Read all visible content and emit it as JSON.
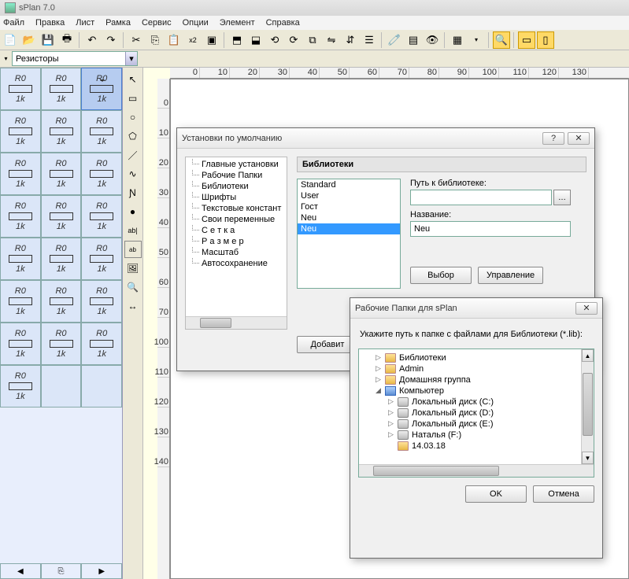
{
  "app": {
    "title": "sPlan 7.0"
  },
  "menu": [
    "Файл",
    "Правка",
    "Лист",
    "Рамка",
    "Сервис",
    "Опции",
    "Элемент",
    "Справка"
  ],
  "toolbar_icons": [
    "new",
    "open",
    "save",
    "print",
    "sep",
    "undo",
    "redo",
    "sep",
    "cut",
    "copy",
    "paste",
    "x2",
    "sep",
    "group",
    "sep",
    "front",
    "back",
    "rotl",
    "rotr",
    "copy2",
    "fliph",
    "flipv",
    "align",
    "sep",
    "clip",
    "num",
    "find",
    "sep",
    "grid",
    "dd",
    "sep",
    "zoom",
    "sep",
    "rect1",
    "rect2"
  ],
  "dropdown": {
    "label": "Резисторы"
  },
  "palette_items": [
    [
      "R0 1k",
      "R0 1k",
      "R0 1k"
    ],
    [
      "R0 R0 1k",
      "R0 R0 1k",
      "R0 R0 1k"
    ],
    [
      "R0 1k",
      "R0 1k",
      "R0 1k"
    ],
    [
      "R0 1k",
      "R0 1k",
      "R0 1k"
    ],
    [
      "R0 1k",
      "R0 1k",
      "R0 1k"
    ],
    [
      "R0 1k",
      "R0 1k",
      "R0 1k"
    ],
    [
      "R0 1k",
      "R0 1k",
      "R0 1k"
    ],
    [
      "R0 1k",
      "",
      ""
    ]
  ],
  "ruler_marks": [
    0,
    10,
    20,
    30,
    40,
    50,
    60,
    70,
    80,
    90,
    100,
    110,
    120,
    130
  ],
  "ruler_v": [
    0,
    10,
    20,
    30,
    40,
    50,
    60,
    70,
    100,
    110,
    120,
    130,
    140
  ],
  "dialog1": {
    "title": "Установки по умолчанию",
    "tree": [
      "Главные установки",
      "Рабочие Папки",
      "Библиотеки",
      "Шрифты",
      "Текстовые констант",
      "Свои переменные",
      "С е т к а",
      "Р а з м е р",
      "Масштаб",
      "Автосохранение"
    ],
    "section": "Библиотеки",
    "libs": [
      "Standard",
      "User",
      "Гост",
      "Neu",
      "Neu"
    ],
    "lib_selected_index": 4,
    "path_label": "Путь к библиотеке:",
    "path_value": "",
    "name_label": "Название:",
    "name_value": "Neu",
    "btn_select": "Выбор",
    "btn_manage": "Управление",
    "btn_add": "Добавит"
  },
  "dialog2": {
    "title": "Рабочие Папки для sPlan",
    "instruction": "Укажите путь к папке с файлами для Библиотеки (*.lib):",
    "tree": [
      {
        "label": "Библиотеки",
        "icon": "folder",
        "ind": 1,
        "exp": "▷"
      },
      {
        "label": "Admin",
        "icon": "folder",
        "ind": 1,
        "exp": "▷"
      },
      {
        "label": "Домашняя группа",
        "icon": "group",
        "ind": 1,
        "exp": "▷"
      },
      {
        "label": "Компьютер",
        "icon": "comp",
        "ind": 1,
        "exp": "◢"
      },
      {
        "label": "Локальный диск (C:)",
        "icon": "drive",
        "ind": 2,
        "exp": "▷"
      },
      {
        "label": "Локальный диск (D:)",
        "icon": "drive",
        "ind": 2,
        "exp": "▷"
      },
      {
        "label": "Локальный диск (E:)",
        "icon": "drive",
        "ind": 2,
        "exp": "▷"
      },
      {
        "label": "Наталья (F:)",
        "icon": "drive",
        "ind": 2,
        "exp": "▷"
      },
      {
        "label": "14.03.18",
        "icon": "folder",
        "ind": 2,
        "exp": ""
      }
    ],
    "ok": "OK",
    "cancel": "Отмена"
  }
}
